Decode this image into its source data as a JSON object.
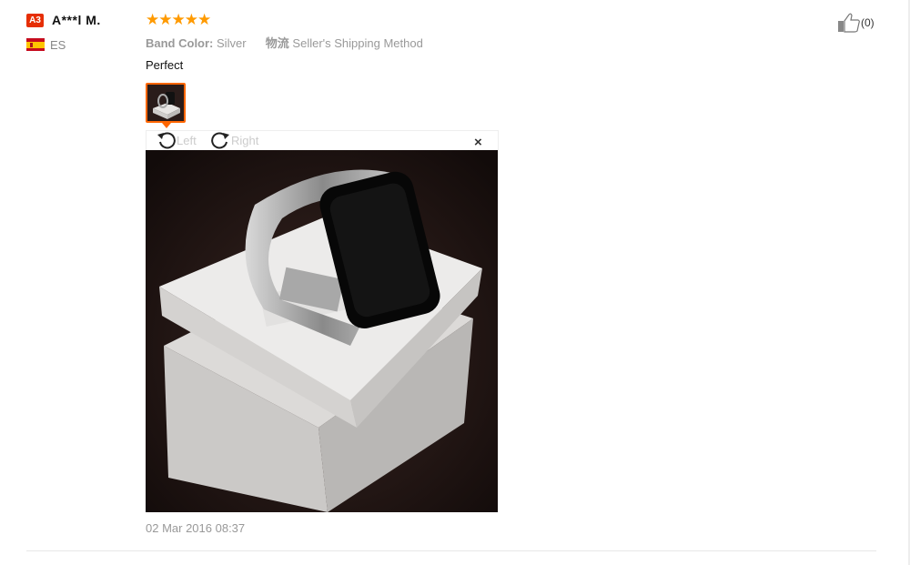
{
  "reviewer": {
    "level_badge": "A3",
    "name": "A***l M.",
    "country_code": "ES"
  },
  "rating": {
    "stars": "★★★★★",
    "value": 5,
    "max": 5
  },
  "sku": {
    "band_label": "Band Color:",
    "band_value": "Silver",
    "shipping_label": "物流",
    "shipping_value": "Seller's Shipping Method"
  },
  "helpful": {
    "count": "(0)"
  },
  "review": {
    "text": "Perfect",
    "date": "02 Mar 2016 08:37"
  },
  "viewer": {
    "rotate_left": "Left",
    "rotate_right": "Right",
    "close": "×"
  },
  "colors": {
    "accent": "#ff6600",
    "star": "#ff9a00",
    "badge": "#e62e04",
    "muted": "#999999"
  }
}
